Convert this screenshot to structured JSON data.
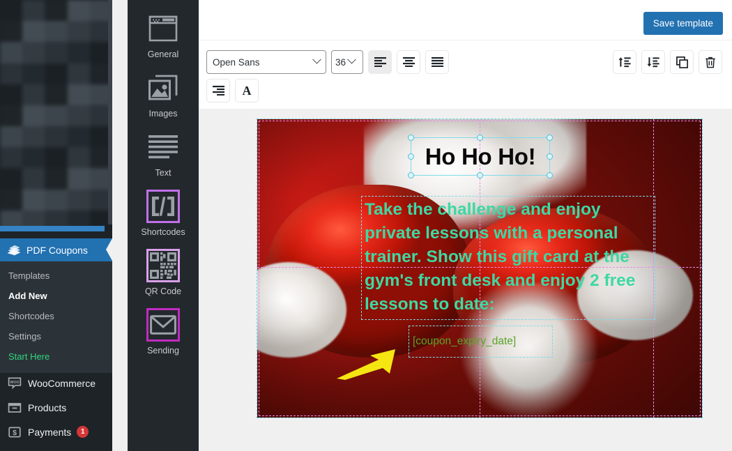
{
  "wp_sidebar": {
    "current_menu": {
      "label": "PDF Coupons",
      "icon": "coupons-stack-icon",
      "highlight_color": "#2271b1"
    },
    "submenu": [
      {
        "label": "Templates",
        "state": "normal"
      },
      {
        "label": "Add New",
        "state": "active"
      },
      {
        "label": "Shortcodes",
        "state": "normal"
      },
      {
        "label": "Settings",
        "state": "normal"
      },
      {
        "label": "Start Here",
        "state": "highlight",
        "color": "#2fd67f"
      }
    ],
    "bottom_items": [
      {
        "label": "WooCommerce",
        "icon": "woo-bubble-icon",
        "badge": ""
      },
      {
        "label": "Products",
        "icon": "products-box-icon",
        "badge": ""
      },
      {
        "label": "Payments",
        "icon": "payments-dollar-icon",
        "badge": "1",
        "badge_color": "#d63638"
      }
    ]
  },
  "rail": {
    "items": [
      {
        "label": "General",
        "icon": "window-layout-icon",
        "framed": false
      },
      {
        "label": "Images",
        "icon": "image-stack-icon",
        "framed": false
      },
      {
        "label": "Text",
        "icon": "text-lines-icon",
        "framed": false
      },
      {
        "label": "Shortcodes",
        "icon": "code-brackets-icon",
        "framed": true,
        "frame_color": "#c070e8"
      },
      {
        "label": "QR Code",
        "icon": "qr-code-icon",
        "framed": true,
        "frame_color": "#d9a0e8"
      },
      {
        "label": "Sending",
        "icon": "envelope-icon",
        "framed": true,
        "frame_color": "#c02bc0"
      }
    ]
  },
  "topbar": {
    "save_label": "Save template",
    "save_color": "#2271b1"
  },
  "toolbar": {
    "font_family": "Open Sans",
    "font_size": "36",
    "buttons": [
      {
        "name": "align-left",
        "label": "Align left",
        "active": true
      },
      {
        "name": "align-center",
        "label": "Align center",
        "active": false
      },
      {
        "name": "align-justify",
        "label": "Justify",
        "active": false
      },
      {
        "name": "align-right",
        "label": "Align right",
        "active": false
      },
      {
        "name": "font-color",
        "label": "A",
        "active": false
      }
    ],
    "right_buttons": [
      {
        "name": "bring-forward",
        "label": "Bring forward"
      },
      {
        "name": "send-backward",
        "label": "Send backward"
      },
      {
        "name": "duplicate",
        "label": "Duplicate"
      },
      {
        "name": "delete",
        "label": "Delete"
      }
    ]
  },
  "canvas": {
    "title_text": "Ho Ho Ho!",
    "title_color": "#0a0a0a",
    "body_text": "Take the challenge and enjoy private lessons with a personal trainer. Show this gift card at the gym's front desk and enjoy 2 free lessons to date:",
    "body_color": "#3ed8a3",
    "date_placeholder": "[coupon_expiry_date]",
    "date_color": "#5aa52a",
    "selection_color": "#7fdcea",
    "guide_color": "#e88be8",
    "annotation": {
      "name": "yellow-arrow",
      "color": "#f5e612"
    }
  }
}
